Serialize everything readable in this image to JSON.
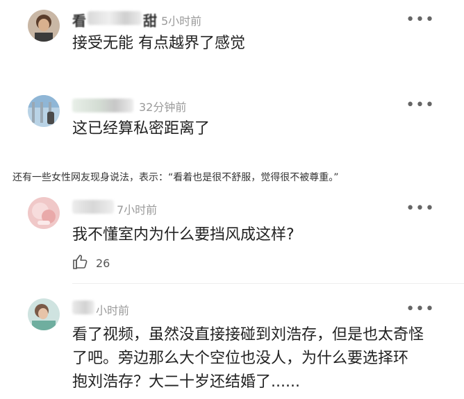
{
  "caption": "还有一些女性网友现身说法，表示：“看着也是很不舒服，觉得很不被尊重。”",
  "comments": [
    {
      "name_fragment_left": "看",
      "name_fragment_right": "甜",
      "time": "5小时前",
      "text": "接受无能 有点越界了感觉",
      "more": "•••"
    },
    {
      "time": "32分钟前",
      "text": "这已经算私密距离了",
      "more": "•••"
    },
    {
      "time": "7小时前",
      "text": "我不懂室内为什么要挡风成这样?",
      "likes": "26",
      "more": "•••"
    },
    {
      "time": "小时前",
      "text_lines": [
        "看了视频，虽然没直接接碰到刘浩存，但是也太奇怪",
        "了吧。旁边那么大个空位也没人，为什么要选择环",
        "抱刘浩存？大二十岁还结婚了......"
      ],
      "more": "•••"
    }
  ]
}
